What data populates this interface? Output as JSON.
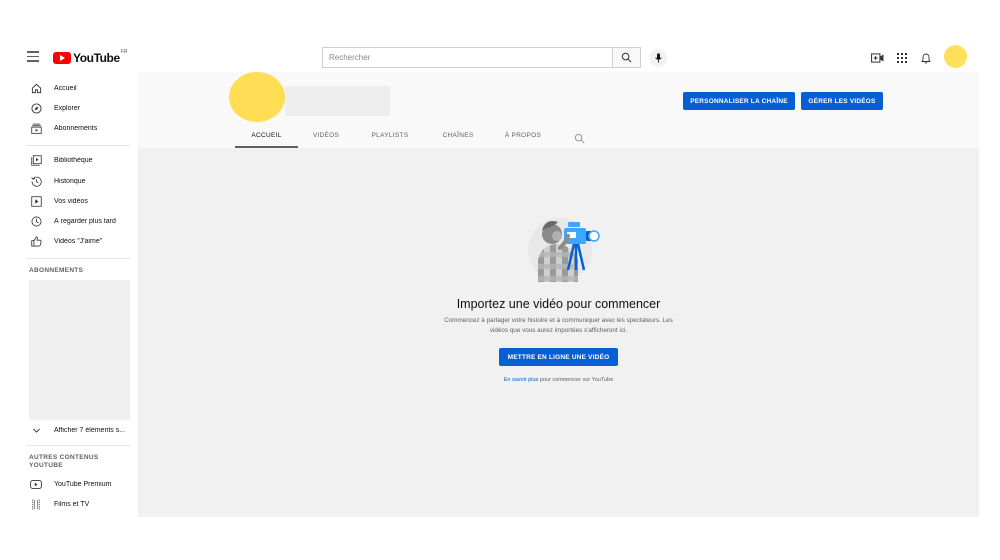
{
  "header": {
    "logo_text": "YouTube",
    "logo_country": "FR",
    "search_placeholder": "Rechercher",
    "icons": [
      "menu-icon",
      "search-icon",
      "microphone-icon",
      "create-video-icon",
      "apps-grid-icon",
      "notifications-bell-icon"
    ]
  },
  "sidebar": {
    "primary": [
      {
        "label": "Accueil",
        "icon": "home-icon"
      },
      {
        "label": "Explorer",
        "icon": "compass-icon"
      },
      {
        "label": "Abonnements",
        "icon": "subscriptions-icon"
      }
    ],
    "library": [
      {
        "label": "Bibliothèque",
        "icon": "library-icon"
      },
      {
        "label": "Historique",
        "icon": "history-icon"
      },
      {
        "label": "Vos vidéos",
        "icon": "your-videos-icon"
      },
      {
        "label": "À regarder plus tard",
        "icon": "clock-icon"
      },
      {
        "label": "Vidéos \"J'aime\"",
        "icon": "thumbs-up-icon"
      }
    ],
    "subscriptions_heading": "ABONNEMENTS",
    "show_more_label": "Afficher 7 éléments s...",
    "more_heading": "AUTRES CONTENUS YOUTUBE",
    "more": [
      {
        "label": "YouTube Premium",
        "icon": "youtube-premium-icon"
      },
      {
        "label": "Films et TV",
        "icon": "film-icon"
      }
    ]
  },
  "channel": {
    "customize_button": "PERSONNALISER LA CHAÎNE",
    "manage_button": "GÉRER LES VIDÉOS",
    "tabs": [
      {
        "label": "ACCUEIL",
        "active": true
      },
      {
        "label": "VIDÉOS",
        "active": false
      },
      {
        "label": "PLAYLISTS",
        "active": false
      },
      {
        "label": "CHAÎNES",
        "active": false
      },
      {
        "label": "À PROPOS",
        "active": false
      }
    ]
  },
  "empty_state": {
    "title": "Importez une vidéo pour commencer",
    "description": "Commencez à partager votre histoire et à communiquer avec les spectateurs. Les vidéos que vous aurez importées s'afficheront ici.",
    "upload_button": "METTRE EN LIGNE UNE VIDÉO",
    "learn_more_link": "En savoir plus",
    "learn_more_rest": " pour commencer sur YouTube"
  },
  "colors": {
    "accent_blue": "#065fd4",
    "avatar_yellow": "#ffdd55",
    "logo_red": "#ff0000"
  }
}
